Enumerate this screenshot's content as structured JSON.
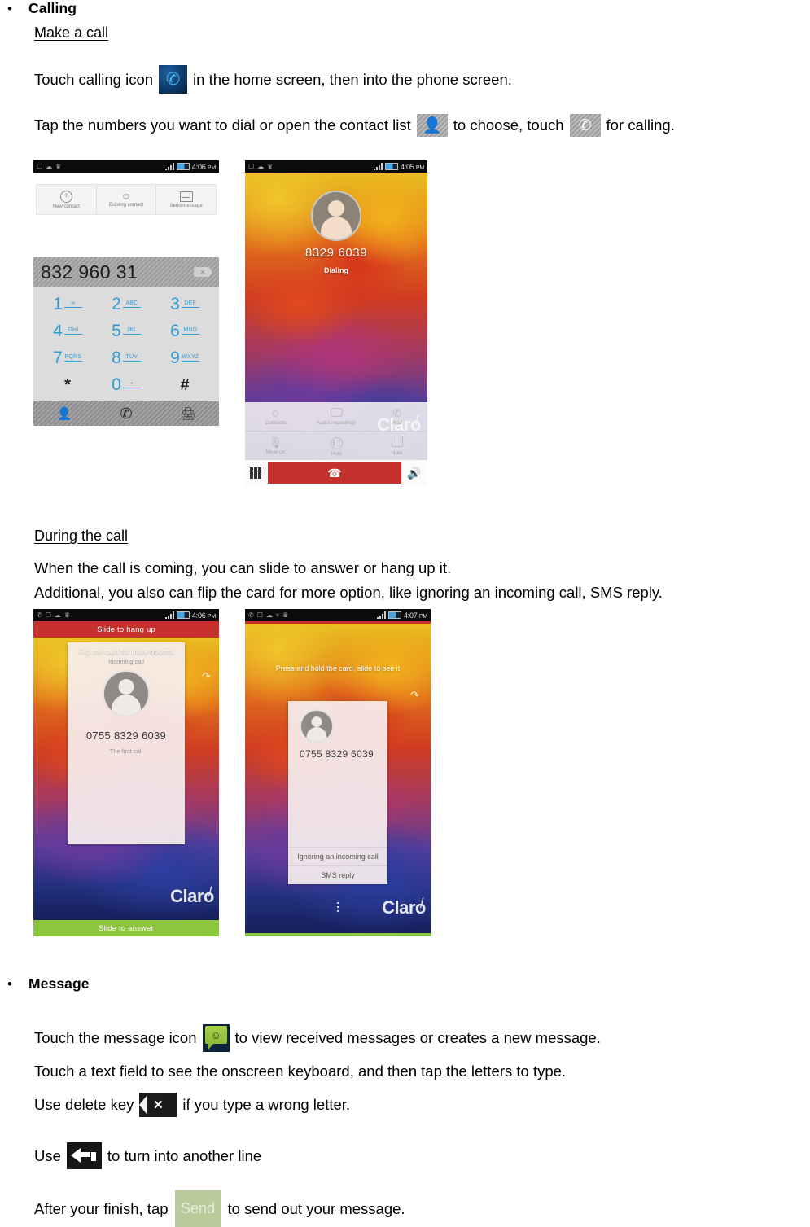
{
  "document": {
    "sections": [
      {
        "bullet": "•",
        "heading": "Calling",
        "subheading": "Make a call",
        "paragraphs": [
          {
            "before": "Touch calling icon",
            "after": "in the home screen, then into the phone screen."
          },
          {
            "before": "Tap the numbers you want to dial or open the contact list",
            "middle": "to choose, touch",
            "after": "for calling."
          }
        ]
      },
      {
        "subheading": "During the call",
        "lines": [
          "When the call is coming, you can slide to answer or hang up it.",
          "Additional, you also can flip the card for more option, like ignoring an incoming call, SMS reply."
        ]
      },
      {
        "bullet": "•",
        "heading": "Message",
        "paragraphs": [
          {
            "before": "Touch the message icon",
            "after": "to view received messages or creates a new message."
          },
          {
            "full": "Touch a text field to see the onscreen keyboard, and then tap the letters to type."
          },
          {
            "before": "Use delete key",
            "after": "if you type a wrong letter."
          },
          {
            "before": "Use",
            "after": "to turn into another line"
          },
          {
            "before": "After your finish, tap",
            "after": "to send out your message."
          }
        ]
      }
    ]
  },
  "icons": {
    "calling_app": "phone-icon",
    "contact_list": "contact-person-icon",
    "call_button": "phone-handset-icon",
    "message_app": "message-bubble-icon",
    "delete_key": "backspace-delete-icon",
    "enter_key": "enter-return-icon",
    "send_button_label": "Send"
  },
  "screenshot_dialer": {
    "status_bar": {
      "time": "4:06",
      "meridiem": "PM"
    },
    "contact_actions": [
      {
        "icon": "plus-circle-icon",
        "label": "New contact",
        "glyph": "+"
      },
      {
        "icon": "person-add-icon",
        "label": "Existing contact",
        "glyph": "☻"
      },
      {
        "icon": "message-lines-icon",
        "label": "Send message",
        "glyph": ""
      }
    ],
    "dialed_number": "832 960 31",
    "backspace_glyph": "✕",
    "keys": [
      {
        "digit": "1",
        "letters": "∞"
      },
      {
        "digit": "2",
        "letters": "ABC"
      },
      {
        "digit": "3",
        "letters": "DEF"
      },
      {
        "digit": "4",
        "letters": "GHI"
      },
      {
        "digit": "5",
        "letters": "JKL"
      },
      {
        "digit": "6",
        "letters": "MNO"
      },
      {
        "digit": "7",
        "letters": "PQRS"
      },
      {
        "digit": "8",
        "letters": "TUV"
      },
      {
        "digit": "9",
        "letters": "WXYZ"
      },
      {
        "digit": "*",
        "letters": ""
      },
      {
        "digit": "0",
        "letters": "+"
      },
      {
        "digit": "#",
        "letters": ""
      }
    ],
    "footer": [
      {
        "icon": "contacts-icon",
        "glyph": "♟"
      },
      {
        "icon": "call-icon",
        "glyph": "✆"
      },
      {
        "icon": "call-log-icon",
        "glyph": "⛃"
      }
    ]
  },
  "screenshot_incall": {
    "status_bar": {
      "time": "4:05",
      "meridiem": "PM"
    },
    "number": "8329 6039",
    "state": "Dialing",
    "watermark": "Claro",
    "options": [
      {
        "icon": "contacts-icon",
        "label": "Contacts"
      },
      {
        "icon": "audio-recordings-icon",
        "label": "Audio recordings"
      },
      {
        "icon": "add-call-icon",
        "label": "Add"
      },
      {
        "icon": "mute-icon",
        "label": "Mute on"
      },
      {
        "icon": "hold-icon",
        "label": "Hold"
      },
      {
        "icon": "note-icon",
        "label": "Note"
      }
    ],
    "end_call_icon": "end-call-icon",
    "keypad_icon": "dialpad-icon",
    "speaker_icon": "speaker-icon"
  },
  "screenshot_incoming": {
    "status_bar": {
      "time": "4:06",
      "meridiem": "PM"
    },
    "top_action": "Slide to hang up",
    "card_hint": "Flip the card for more options",
    "card_type": "Incoming call",
    "number": "0755 8329 6039",
    "note": "The first call",
    "watermark": "Claro",
    "bottom_action": "Slide to answer"
  },
  "screenshot_cardflip": {
    "status_bar": {
      "time": "4:07",
      "meridiem": "PM"
    },
    "hint": "Press and hold the card, slide to see it",
    "number": "0755 8329 6039",
    "options": [
      "Ignoring an incoming call",
      "SMS reply"
    ],
    "watermark": "Claro"
  },
  "colors": {
    "accent_blue": "#2e9ad6",
    "red_bar": "#c6302d",
    "green_bar": "#8cc63e",
    "send_button": "#b9cb9b",
    "msg_green": "#8dbb36"
  }
}
